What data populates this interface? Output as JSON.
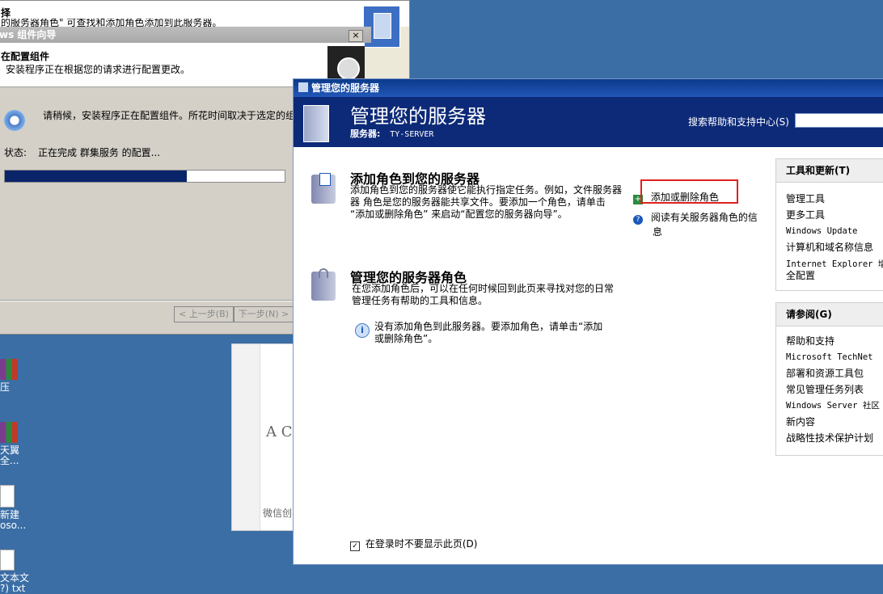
{
  "desktop": {
    "icons": [
      {
        "label1": "压",
        "label2": ""
      },
      {
        "label1": "天翼",
        "label2": "全..."
      },
      {
        "label1": "新建",
        "label2": "oso..."
      },
      {
        "label1": "文本文",
        "label2": "?) txt"
      }
    ]
  },
  "wizard": {
    "top_title": "择",
    "top_subtitle": "的服务器角色\" 可查找和添加角色添加到此服务器。",
    "window_title": "ws 组件向导",
    "close_label": "×",
    "header_title": "在配置组件",
    "header_desc": "安装程序正在根据您的请求进行配置更改。",
    "wait_text": "请稍候，安装程序正在配置组件。所花时间取决于选定的组",
    "status_label": "状态:",
    "status_value": "正在完成 群集服务 的配置...",
    "progress": 0.65,
    "back_button": "< 上一步(B)",
    "next_button": "下一步(N) >"
  },
  "background_doc": {
    "letter": "A C",
    "text": "微信创"
  },
  "server_manager": {
    "title": "管理您的服务器",
    "banner_title": "管理您的服务器",
    "server_label": "服务器:",
    "server_name": "TY-SERVER",
    "search_label": "搜索帮助和支持中心(S)",
    "search_value": "",
    "section1": {
      "title": "添加角色到您的服务器",
      "desc1": "添加角色到您的服务器使它能执行指定任务。例如，文件服务器",
      "desc2": "器 角色是您的服务器能共享文件。要添加一个角色，请单击",
      "desc3": "“添加或删除角色” 来启动“配置您的服务器向导”。",
      "action_add_remove": "添加或删除角色",
      "action_read1": "阅读有关服务器角色的信",
      "action_read2": "息"
    },
    "section2": {
      "title": "管理您的服务器角色",
      "desc1": "在您添加角色后，可以在任何时候回到此页来寻找对您的日常",
      "desc2": "管理任务有帮助的工具和信息。",
      "info1": "没有添加角色到此服务器。要添加角色，请单击“添加",
      "info2": "或删除角色”。"
    },
    "checkbox_label": "在登录时不要显示此页(D)",
    "checkbox_checked": true,
    "tools_panel": {
      "header": "工具和更新(T)",
      "items": [
        "管理工具",
        "更多工具",
        "Windows Update",
        "计算机和域名称信息",
        "Internet Explorer 增",
        "全配置"
      ]
    },
    "see_also_panel": {
      "header": "请参阅(G)",
      "items": [
        "帮助和支持",
        "Microsoft TechNet",
        "部署和资源工具包",
        "常见管理任务列表",
        "Windows Server 社区",
        "新内容",
        "战略性技术保护计划"
      ]
    },
    "colors": {
      "title_bar": "#0b3a8a",
      "banner": "#0d2a78",
      "highlight": "#e02020"
    }
  }
}
